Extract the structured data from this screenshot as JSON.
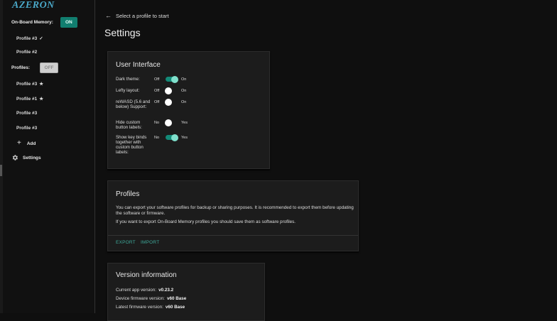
{
  "brand": {
    "logo_text": "AZERON"
  },
  "sidebar": {
    "onboard_memory_label": "On-Board Memory:",
    "onboard_memory_toggle": "ON",
    "onboard_profiles": [
      {
        "label": "Profile #3",
        "mark": "✓"
      },
      {
        "label": "Profile #2",
        "mark": ""
      }
    ],
    "profiles_label": "Profiles:",
    "profiles_toggle": "OFF",
    "profiles": [
      {
        "label": "Profile #3",
        "mark": "★"
      },
      {
        "label": "Profile #1",
        "mark": "★"
      },
      {
        "label": "Profile #3",
        "mark": ""
      },
      {
        "label": "Profile #3",
        "mark": ""
      }
    ],
    "add_label": "Add",
    "settings_label": "Settings"
  },
  "header": {
    "back_label": "Select a profile to start",
    "page_title": "Settings"
  },
  "ui_card": {
    "title": "User Interface",
    "settings": [
      {
        "label": "Dark theme:",
        "off": "Off",
        "on": "On",
        "state": "on"
      },
      {
        "label": "Lefty layout:",
        "off": "Off",
        "on": "On",
        "state": "off"
      },
      {
        "label": "reWASD (5.6 and below) Support:",
        "off": "Off",
        "on": "On",
        "state": "off"
      },
      {
        "label": "Hide custom button labels:",
        "off": "No",
        "on": "Yes",
        "state": "off"
      },
      {
        "label": "Show key binds together with custom button labels:",
        "off": "No",
        "on": "Yes",
        "state": "on"
      }
    ]
  },
  "profiles_card": {
    "title": "Profiles",
    "text1": "You can export your software profiles for backup or sharing purposes. It is recommended to export them before updating the software or firmware.",
    "text2": "If you want to export On-Board Memory profiles you should save them as software profiles.",
    "export_label": "EXPORT",
    "import_label": "IMPORT"
  },
  "version_card": {
    "title": "Version information",
    "rows": [
      {
        "label": "Current app version:",
        "value": "v0.23.2"
      },
      {
        "label": "Device firmware version:",
        "value": "v60 Base"
      },
      {
        "label": "Latest firmware version:",
        "value": "v60 Base"
      }
    ]
  },
  "colors": {
    "accent": "#117e6f",
    "link": "#3ea99a",
    "background": "#0f0f0f"
  }
}
